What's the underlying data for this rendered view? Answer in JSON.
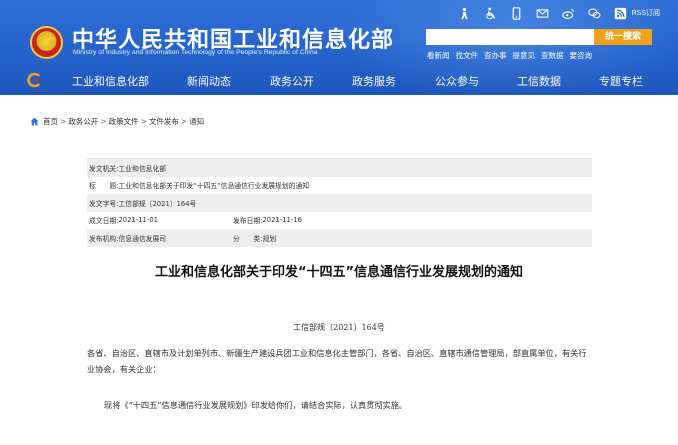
{
  "header": {
    "title": "中华人民共和国工业和信息化部",
    "subtitle": "Ministry of Industry and Information Technology of the People's Republic of China",
    "rss_label": "RSS订阅",
    "search_button": "统一搜索",
    "search_placeholder": "",
    "hot_links": [
      "看新闻",
      "找文件",
      "查办事",
      "提意见",
      "查数据",
      "要咨询"
    ],
    "icons": [
      "accessibility-elder-icon",
      "accessibility-wheelchair-icon",
      "mobile-icon",
      "mail-icon",
      "weibo-icon",
      "wechat-icon",
      "rss-icon"
    ]
  },
  "nav": {
    "items": [
      "工业和信息化部",
      "新闻动态",
      "政务公开",
      "政务服务",
      "公众参与",
      "工信数据",
      "专题专栏"
    ]
  },
  "breadcrumb": [
    "首页",
    "政务公开",
    "政策文件",
    "文件发布",
    "通知"
  ],
  "info": {
    "issuer_label": "发文机关:",
    "issuer": "工业和信息化部",
    "title_label": "标　　题:",
    "title": "工业和信息化部关于印发“十四五”信息通信行业发展规划的通知",
    "docno_label": "发文字号:",
    "docno": "工信部规〔2021〕164号",
    "created_label": "成文日期:",
    "created": "2021-11-01",
    "published_label": "发布日期:",
    "published": "2021-11-16",
    "org_label": "发布机构:",
    "org": "信息通信发展司",
    "category_label": "分　　类:",
    "category": "规划"
  },
  "article": {
    "title": "工业和信息化部关于印发“十四五”信息通信行业发展规划的通知",
    "doc_number": "工信部规〔2021〕164号",
    "para1": "各省、自治区、直辖市及计划单列市、新疆生产建设兵团工业和信息化主管部门，各省、自治区、直辖市通信管理局，部直属单位，有关行业协会，有关企业：",
    "para2": "现将《“十四五”信息通信行业发展规划》印发给你们，请结合实际，认真贯彻实施。"
  },
  "colors": {
    "header_blue": "#2563cc",
    "search_orange": "#f0a21b",
    "info_shade": "#eeeeee",
    "breadcrumb_icon": "#2f6fd6"
  }
}
